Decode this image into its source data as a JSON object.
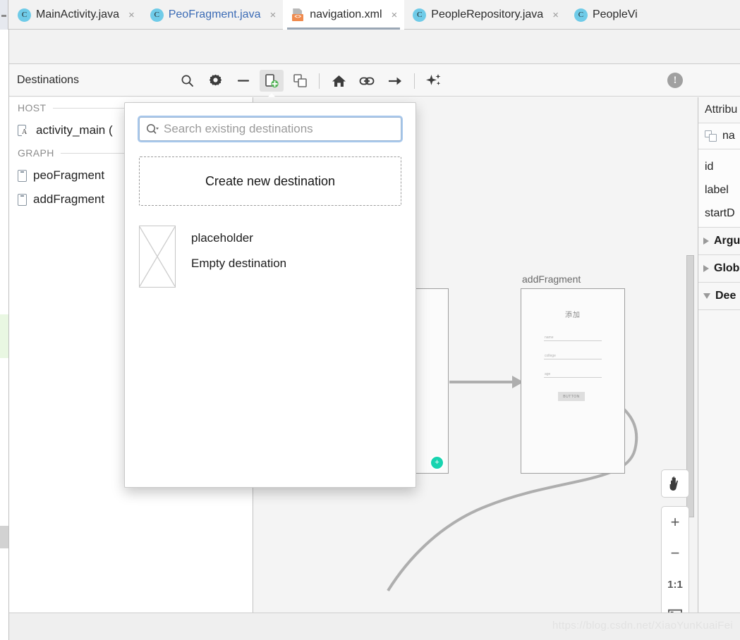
{
  "window": {
    "tabs": [
      {
        "label": "MainActivity.java",
        "icon": "java-class-icon",
        "active": false,
        "accent": "normal",
        "closable": true
      },
      {
        "label": "PeoFragment.java",
        "icon": "java-class-icon",
        "active": false,
        "accent": "blue",
        "closable": true
      },
      {
        "label": "navigation.xml",
        "icon": "xml-resource-icon",
        "active": true,
        "accent": "normal",
        "closable": true
      },
      {
        "label": "PeopleRepository.java",
        "icon": "java-class-icon",
        "active": false,
        "accent": "normal",
        "closable": true
      },
      {
        "label": "PeopleVi",
        "icon": "java-class-icon",
        "active": false,
        "accent": "normal",
        "closable": false
      }
    ],
    "close_glyph": "×",
    "xml_badge": "<>",
    "java_badge": "C"
  },
  "toolbar": {
    "title": "Destinations",
    "buttons": [
      {
        "name": "zoom-in-search",
        "icon": "search-icon",
        "glyph": "🔍"
      },
      {
        "name": "settings",
        "icon": "gear-icon",
        "glyph": "⚙"
      },
      {
        "name": "remove-destination",
        "icon": "minus-icon",
        "glyph": "−"
      },
      {
        "name": "new-destination",
        "icon": "new-destination-icon",
        "glyph": ""
      },
      {
        "name": "new-nested-graph",
        "icon": "nested-graph-icon",
        "glyph": ""
      },
      {
        "name": "set-start-destination",
        "icon": "home-icon",
        "glyph": "⌂"
      },
      {
        "name": "add-action",
        "icon": "link-icon",
        "glyph": "🔗"
      },
      {
        "name": "add-deep-link",
        "icon": "arrow-right-icon",
        "glyph": "→"
      },
      {
        "name": "auto-arrange",
        "icon": "sparkle-icon",
        "glyph": "✦"
      }
    ],
    "issue_glyph": "!"
  },
  "destinations": {
    "sections": [
      {
        "label": "HOST",
        "items": [
          {
            "label": "activity_main (",
            "icon": "activity-icon"
          }
        ]
      },
      {
        "label": "GRAPH",
        "items": [
          {
            "label": "peoFragment",
            "icon": "fragment-icon"
          },
          {
            "label": "addFragment",
            "icon": "fragment-icon"
          }
        ]
      }
    ]
  },
  "popup": {
    "search": {
      "value": "",
      "placeholder": "Search existing destinations",
      "icon": "search-dropdown-icon"
    },
    "create_label": "Create new destination",
    "items": [
      {
        "title": "placeholder",
        "subtitle": "Empty destination",
        "thumb": "crossed-rect-thumbnail"
      }
    ]
  },
  "canvas": {
    "fragments": [
      {
        "name": "peoFragment",
        "label": "",
        "preview": {
          "title": "",
          "fields": [],
          "button": ""
        }
      },
      {
        "name": "addFragment",
        "label": "addFragment",
        "preview": {
          "title": "添加",
          "fields": [
            "name",
            "college",
            "age"
          ],
          "button": "BUTTON"
        }
      }
    ],
    "controls": {
      "pan": {
        "label": "",
        "icon": "hand-icon"
      },
      "zoom_in": "+",
      "zoom_out": "−",
      "zoom_actual": "1:1",
      "zoom_fit": "⬚"
    }
  },
  "attributes": {
    "header": "Attribu",
    "selection": {
      "label": "na",
      "icon": "nested-graph-icon"
    },
    "rows": [
      {
        "label": "id"
      },
      {
        "label": "label"
      },
      {
        "label": "startD"
      }
    ],
    "sections": [
      {
        "label": "Argu",
        "expanded": false
      },
      {
        "label": "Glob",
        "expanded": false
      },
      {
        "label": "Dee",
        "expanded": true
      }
    ]
  },
  "footer": {
    "watermark": "https://blog.csdn.net/XiaoYunKuaiFei"
  },
  "colors": {
    "accent_blue": "#6fcbe8",
    "xml_orange": "#f08b4e",
    "connector_teal": "#18d4b0",
    "focus_ring": "#a8c8ec",
    "green_plus": "#4caf50"
  }
}
